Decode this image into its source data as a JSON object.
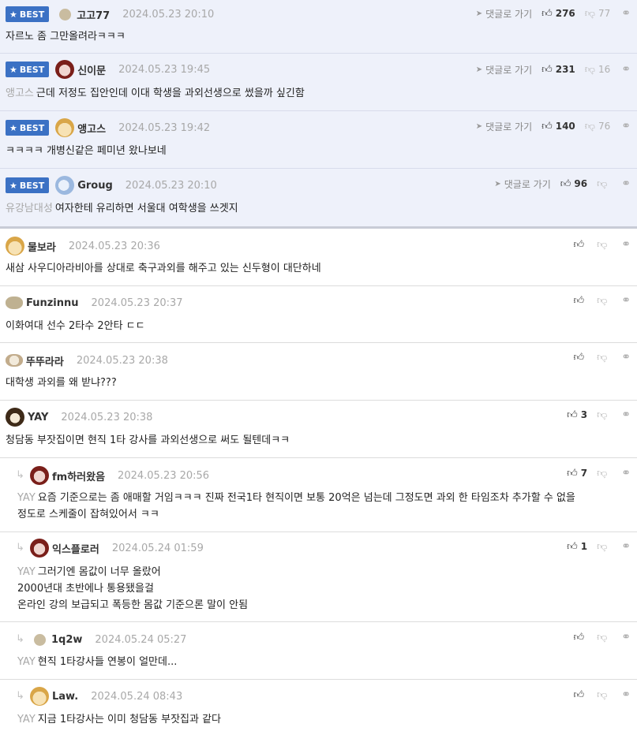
{
  "best_label": "BEST",
  "goto_label": "댓글로 가기",
  "comments": [
    {
      "nick": "고고77",
      "date": "2024.05.23 20:10",
      "up": "276",
      "down": "77",
      "mention": "",
      "lines": [
        "자르노 좀 그만올려라ㅋㅋㅋ"
      ],
      "avatar": "dot-icon"
    },
    {
      "nick": "신이문",
      "date": "2024.05.23 19:45",
      "up": "231",
      "down": "16",
      "mention": "앵고스",
      "lines": [
        "근데 저정도 집안인데 이대 학생을 과외선생으로 썼을까 싶긴함"
      ],
      "avatar": "face-avatar-icon"
    },
    {
      "nick": "앵고스",
      "date": "2024.05.23 19:42",
      "up": "140",
      "down": "76",
      "mention": "",
      "lines": [
        "ㅋㅋㅋㅋ 개병신같은 페미년 왔나보네"
      ],
      "avatar": "dog-avatar-icon"
    },
    {
      "nick": "Groug",
      "date": "2024.05.23 20:10",
      "up": "96",
      "down": "",
      "mention": "유강남대성",
      "lines": [
        "여자한테 유리하면 서울대 여학생을 쓰겟지"
      ],
      "avatar": "blue-avatar-icon"
    },
    {
      "nick": "물보라",
      "date": "2024.05.23 20:36",
      "up": "",
      "down": "",
      "mention": "",
      "lines": [
        "새삼 사우디아라비아를 상대로 축구과외를 해주고 있는 신두형이 대단하네"
      ],
      "avatar": "dog-avatar-icon"
    },
    {
      "nick": "Funzinnu",
      "date": "2024.05.23 20:37",
      "up": "",
      "down": "",
      "mention": "",
      "lines": [
        "이화여대 선수 2타수 2안타 ㄷㄷ"
      ],
      "avatar": "potato-avatar-icon"
    },
    {
      "nick": "뚜뚜라라",
      "date": "2024.05.23 20:38",
      "up": "",
      "down": "",
      "mention": "",
      "lines": [
        "대학생 과외를 왜 받냐???"
      ],
      "avatar": "bear-avatar-icon"
    },
    {
      "nick": "YAY",
      "date": "2024.05.23 20:38",
      "up": "3",
      "down": "",
      "mention": "",
      "lines": [
        "청담동 부잣집이면 현직 1타 강사를 과외선생으로 써도 될텐데ㅋㅋ"
      ],
      "avatar": "lion-avatar-icon"
    },
    {
      "nick": "fm하러왔음",
      "date": "2024.05.23 20:56",
      "up": "7",
      "down": "",
      "mention": "YAY",
      "lines": [
        "요즘 기준으로는 좀 애매할 거임ㅋㅋㅋ 진짜 전국1타 현직이면 보통 20억은 넘는데 그정도면 과외 한 타임조차 추가할 수 없을",
        "정도로 스케줄이 잡혀있어서 ㅋㅋ"
      ],
      "avatar": "face-avatar-icon"
    },
    {
      "nick": "익스플로러",
      "date": "2024.05.24 01:59",
      "up": "1",
      "down": "",
      "mention": "YAY",
      "lines": [
        "그러기엔 몸값이 너무 올랐어",
        "2000년대 초반에나 통용됐을걸",
        "온라인 강의 보급되고 폭등한 몸값 기준으론 말이 안됨"
      ],
      "avatar": "face-avatar-icon"
    },
    {
      "nick": "1q2w",
      "date": "2024.05.24 05:27",
      "up": "",
      "down": "",
      "mention": "YAY",
      "lines": [
        "현직 1타강사들 연봉이 얼만데..."
      ],
      "avatar": "dot-icon"
    },
    {
      "nick": "Law.",
      "date": "2024.05.24 08:43",
      "up": "",
      "down": "",
      "mention": "YAY",
      "lines": [
        "지금 1타강사는 이미 청담동 부잣집과 같다"
      ],
      "avatar": "dog-avatar-icon"
    }
  ]
}
